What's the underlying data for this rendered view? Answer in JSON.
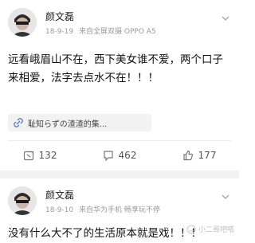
{
  "posts": [
    {
      "author": "颜文磊",
      "date": "18-9-19",
      "source": "来自全屏双摄 OPPO A5",
      "text": "远看峨眉山不在，西下美女谁不爱，两个口子来相爱，法字去点水不在！！！",
      "link_text": "耻知らずの渣渣的集...",
      "repost_count": "132",
      "comment_count": "462",
      "like_count": "177"
    },
    {
      "author": "颜文磊",
      "date": "18-9-10",
      "source": "来自华为手机 畅享玩不停",
      "text": "没有什么大不了的生活原本就是戏！！！"
    }
  ],
  "watermark": "小二哥吧嗒"
}
